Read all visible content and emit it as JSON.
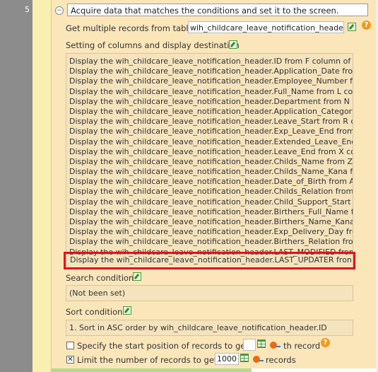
{
  "step": {
    "number": "5"
  },
  "header": {
    "title": "Acquire data that matches the conditions and set it to the screen."
  },
  "table": {
    "label": "Get multiple records from table",
    "value": "wih_childcare_leave_notification_header"
  },
  "columns": {
    "label": "Setting of columns and display destination",
    "rows": [
      "Display the wih_childcare_leave_notification_header.ID from F column of",
      "Display the wih_childcare_leave_notification_header.Application_Date from",
      "Display the wih_childcare_leave_notification_header.Employee_Number fr",
      "Display the wih_childcare_leave_notification_header.Full_Name from L col",
      "Display the wih_childcare_leave_notification_header.Department from N c",
      "Display the wih_childcare_leave_notification_header.Application_Category",
      "Display the wih_childcare_leave_notification_header.Leave_Start from R c",
      "Display the wih_childcare_leave_notification_header.Exp_Leave_End from",
      "Display the wih_childcare_leave_notification_header.Extended_Leave_End",
      "Display the wih_childcare_leave_notification_header.Leave_End from X co",
      "Display the wih_childcare_leave_notification_header.Childs_Name from Z",
      "Display the wih_childcare_leave_notification_header.Childs_Name_Kana fr",
      "Display the wih_childcare_leave_notification_header.Date_of_Birth from A",
      "Display the wih_childcare_leave_notification_header.Childs_Relation from",
      "Display the wih_childcare_leave_notification_header.Child_Support_Start f",
      "Display the wih_childcare_leave_notification_header.Birthers_Full_Name fr",
      "Display the wih_childcare_leave_notification_header.Birthers_Name_Kana",
      "Display the wih_childcare_leave_notification_header.Exp_Delivery_Day fro",
      "Display the wih_childcare_leave_notification_header.Birthers_Relation from",
      "Display the wih_childcare_leave_notification_header.LAST_MODIFIED from"
    ],
    "highlighted_row": "Display the wih_childcare_leave_notification_header.LAST_UPDATER from"
  },
  "search": {
    "label": "Search condition",
    "value": "(Not been set)"
  },
  "sort": {
    "label": "Sort condition",
    "value": "1. Sort in ASC order by wih_childcare_leave_notification_header.ID"
  },
  "start_position": {
    "label": "Specify the start position of records to get.",
    "value": "",
    "suffix": "th record",
    "checked": false
  },
  "limit": {
    "label": "Limit the number of records to get.",
    "value": "1000",
    "suffix": "records",
    "checked": true,
    "check_mark": "✕"
  },
  "icons": {
    "collapse": "minus-circle-icon",
    "help_glyph": "?",
    "collapse_glyph": "−"
  },
  "colors": {
    "panel": "#fbe6ba",
    "highlight_border": "#e8101a",
    "help": "#f09a1a"
  }
}
